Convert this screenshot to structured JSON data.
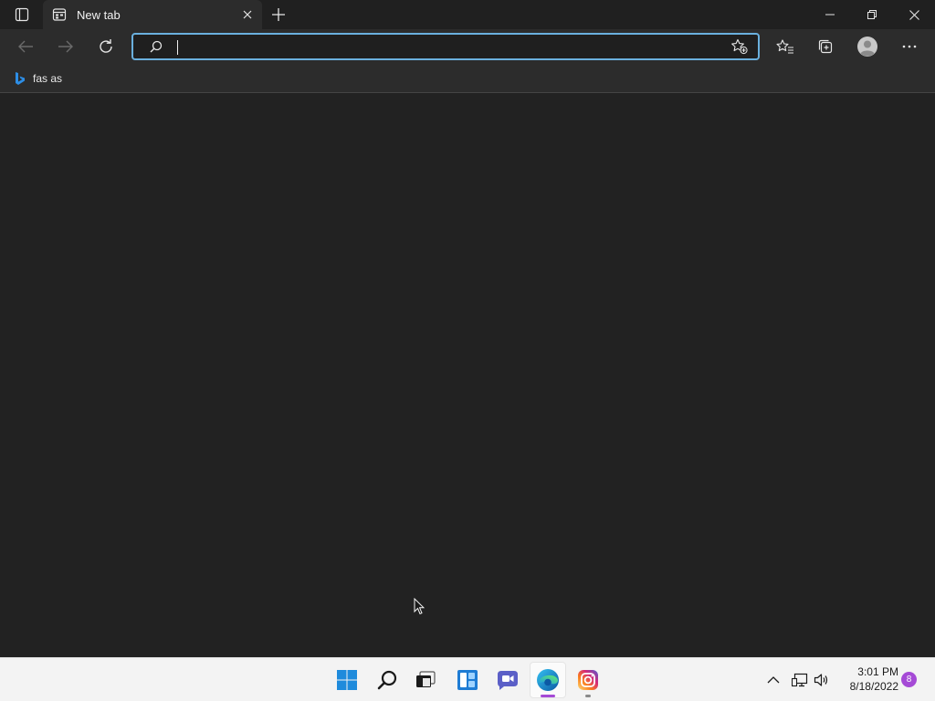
{
  "browser": {
    "tab": {
      "title": "New tab"
    },
    "address": {
      "value": "",
      "placeholder": ""
    },
    "favorites": [
      {
        "label": "fas as",
        "icon": "bing-icon"
      }
    ]
  },
  "taskbar": {
    "apps": [
      {
        "name": "start",
        "icon": "windows-start-icon"
      },
      {
        "name": "search",
        "icon": "search-icon"
      },
      {
        "name": "task-view",
        "icon": "task-view-icon"
      },
      {
        "name": "widgets",
        "icon": "widgets-icon"
      },
      {
        "name": "teams-chat",
        "icon": "chat-icon"
      },
      {
        "name": "edge",
        "icon": "edge-icon",
        "active": true
      },
      {
        "name": "instagram",
        "icon": "instagram-icon"
      }
    ],
    "clock": {
      "time": "3:01 PM",
      "date": "8/18/2022"
    },
    "notifications": "8"
  },
  "colors": {
    "accent_focus": "#6ab0de",
    "chrome_dark": "#2c2c2c",
    "page_bg": "#222222",
    "taskbar_bg": "#f3f3f3",
    "notification_badge": "#a54ad6"
  }
}
